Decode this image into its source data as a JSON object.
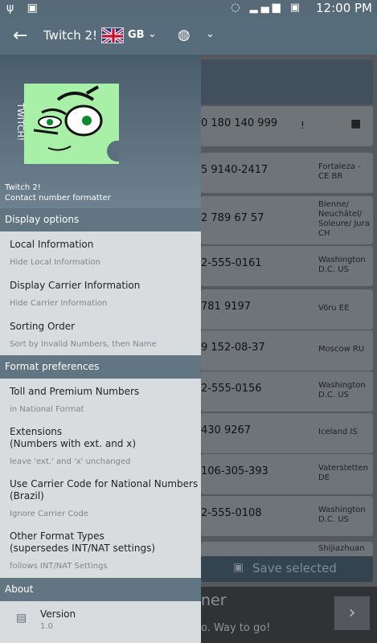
{
  "status": {
    "time": "12:00 PM"
  },
  "appbar": {
    "title": "Twitch 2!",
    "country": "GB"
  },
  "drawer": {
    "app_name": "Twitch 2!",
    "app_subtitle": "Contact number formatter",
    "logo_text": "TWITCH!",
    "sections": {
      "display": "Display options",
      "format": "Format preferences",
      "about": "About"
    },
    "items": [
      {
        "title": "Local Information",
        "subtitle": "Hide Local Information"
      },
      {
        "title": "Display Carrier Information",
        "subtitle": "Hide Carrier Information"
      },
      {
        "title": "Sorting Order",
        "subtitle": "Sort by Invalid Numbers, then Name"
      },
      {
        "title": "Toll and Premium Numbers",
        "subtitle": "in National Format"
      },
      {
        "title": "Extensions",
        "title2": "(Numbers with ext. and x)",
        "subtitle": "leave 'ext.' and 'x' unchanged"
      },
      {
        "title": "Use Carrier Code for National Numbers",
        "title2": "(Brazil)",
        "subtitle": "Ignore Carrier Code"
      },
      {
        "title": "Other Format Types",
        "title2": "(supersedes INT/NAT settings)",
        "subtitle": "follows INT/NAT Settings"
      }
    ],
    "version": {
      "label": "Version",
      "value": "1.0"
    }
  },
  "background": {
    "rows": [
      {
        "number": "0 180 140 999",
        "location": "!"
      },
      {
        "number": "5 9140-2417",
        "location": "Fortaleza - CE BR"
      },
      {
        "number": "2 789 67 57",
        "location": "Bienne/ Neuchâtel/ Soleure/ Jura CH"
      },
      {
        "number": "2-555-0161",
        "location": "Washington D.C. US"
      },
      {
        "number": "781 9197",
        "location": "Võru EE"
      },
      {
        "number": "9 152-08-37",
        "location": "Moscow RU"
      },
      {
        "number": "2-555-0156",
        "location": "Washington D.C. US"
      },
      {
        "number": "430 9267",
        "location": "Iceland IS"
      },
      {
        "number": "106-305-393",
        "location": "Vaterstetten DE"
      },
      {
        "number": "2-555-0108",
        "location": "Washington D.C. US"
      },
      {
        "number": "",
        "location": "Shijiazhuan"
      }
    ],
    "save_label": "Save selected",
    "ad_big": "ner",
    "ad_small": "o. Way to go!"
  }
}
